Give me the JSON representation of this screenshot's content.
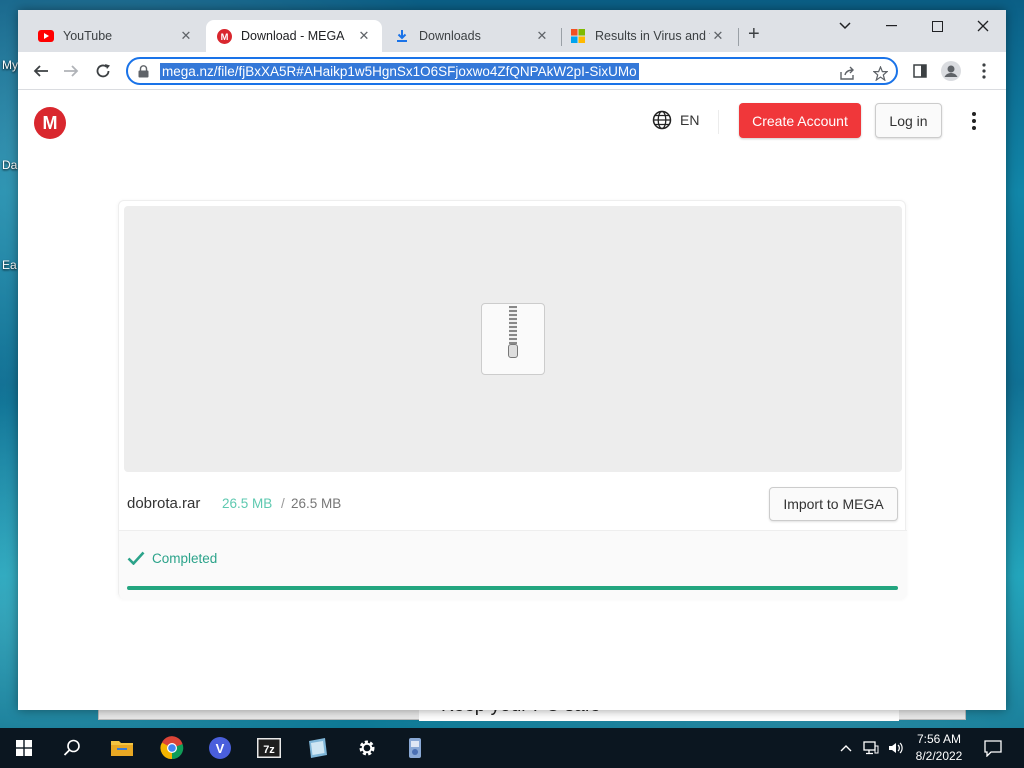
{
  "desktop": {
    "icon_labels": [
      "My",
      "Da",
      "Ea"
    ],
    "behind_window_text": "Keep your PC safe"
  },
  "browser": {
    "tabs": [
      {
        "title": "YouTube",
        "icon": "youtube-icon",
        "active": false
      },
      {
        "title": "Download - MEGA",
        "icon": "mega-icon",
        "active": true
      },
      {
        "title": "Downloads",
        "icon": "download-icon",
        "active": false
      },
      {
        "title": "Results in Virus and th",
        "icon": "microsoft-icon",
        "active": false
      }
    ],
    "url": "mega.nz/file/fjBxXA5R#AHaikp1w5HgnSx1O6SFjoxwo4ZfQNPAkW2pI-SixUMo"
  },
  "mega": {
    "logo_letter": "M",
    "language": "EN",
    "create_account_label": "Create Account",
    "login_label": "Log in",
    "file_name": "dobrota.rar",
    "downloaded_size": "26.5 MB",
    "size_separator": "/",
    "total_size": "26.5 MB",
    "import_label": "Import to MEGA",
    "status": "Completed",
    "progress": 1.0
  },
  "colors": {
    "mega_red": "#d9272e",
    "create_button": "#f0373a",
    "completed_green": "#2ba38a",
    "progress_green": "#23a57f"
  },
  "taskbar": {
    "time": "7:56 AM",
    "date": "8/2/2022"
  }
}
